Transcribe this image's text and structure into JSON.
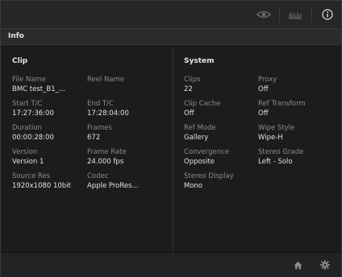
{
  "icons": {
    "viewer": "eye-icon",
    "scope": "waveform-icon",
    "info": "info-icon",
    "home": "home-icon",
    "settings": "gear-icon"
  },
  "panel": {
    "title": "Info"
  },
  "clip": {
    "title": "Clip",
    "fields": [
      {
        "label": "File Name",
        "value": "BMC test_B1_..."
      },
      {
        "label": "Reel Name",
        "value": ""
      },
      {
        "label": "Start T/C",
        "value": "17:27:36:00"
      },
      {
        "label": "End T/C",
        "value": "17:28:04:00"
      },
      {
        "label": "Duration",
        "value": "00:00:28:00"
      },
      {
        "label": "Frames",
        "value": "672"
      },
      {
        "label": "Version",
        "value": "Version 1"
      },
      {
        "label": "Frame Rate",
        "value": "24.000 fps"
      },
      {
        "label": "Source Res",
        "value": "1920x1080 10bit"
      },
      {
        "label": "Codec",
        "value": "Apple ProRes..."
      }
    ]
  },
  "system": {
    "title": "System",
    "fields": [
      {
        "label": "Clips",
        "value": "22"
      },
      {
        "label": "Proxy",
        "value": "Off"
      },
      {
        "label": "Clip Cache",
        "value": "Off"
      },
      {
        "label": "Ref Transform",
        "value": "Off"
      },
      {
        "label": "Ref Mode",
        "value": "Gallery"
      },
      {
        "label": "Wipe Style",
        "value": "Wipe-H"
      },
      {
        "label": "Convergence",
        "value": "Opposite"
      },
      {
        "label": "Stereo Grade",
        "value": "Left - Solo"
      },
      {
        "label": "Stereo Display",
        "value": "Mono"
      }
    ]
  }
}
